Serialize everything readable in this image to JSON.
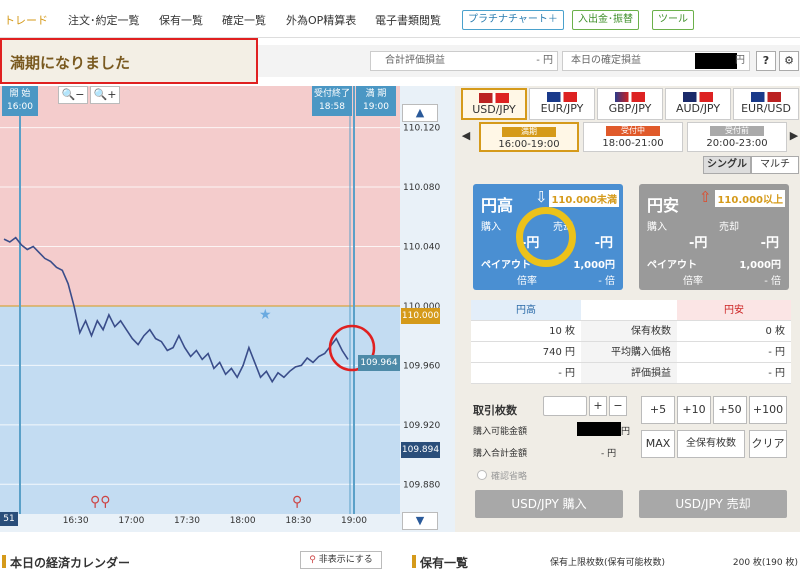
{
  "nav": {
    "items": [
      "トレード",
      "注文･約定一覧",
      "保有一覧",
      "確定一覧",
      "外為OP精算表",
      "電子書類閲覧"
    ],
    "platinum": "プラチナチャート＋",
    "deposit": "入出金･振替",
    "tools": "ツール"
  },
  "banner": {
    "text": "満期になりました"
  },
  "summary": {
    "eval_label": "合計評価損益",
    "eval_value": "- 円",
    "day_label": "本日の確定損益",
    "day_unit": "円",
    "help": "?"
  },
  "chart": {
    "start_label": "開 始",
    "start_time": "16:00",
    "close_label": "受付終了",
    "close_time": "18:58",
    "expiry_label": "満 期",
    "expiry_time": "19:00",
    "x_ticks": [
      "16:00",
      "16:30",
      "17:00",
      "17:30",
      "18:00",
      "18:30",
      "19:00"
    ],
    "x_left_fragment": "51",
    "y_ticks": [
      "110.120",
      "110.080",
      "110.040",
      "110.000",
      "109.960",
      "109.920",
      "109.880"
    ],
    "price_current": "109.964",
    "price_marker": "109.894",
    "strike": "110.000",
    "zoom_out": "−",
    "zoom_in": "+"
  },
  "chart_data": {
    "type": "line",
    "ylim": [
      109.86,
      110.148
    ],
    "xlim": [
      "16:00",
      "19:00"
    ],
    "strike": 110.0,
    "series": [
      {
        "values": [
          110.045,
          110.043,
          110.046,
          110.041,
          110.038,
          110.04,
          110.036,
          110.032,
          110.03,
          110.026,
          110.024,
          110.015,
          110.0,
          109.982,
          109.99,
          109.98,
          109.99,
          109.984,
          109.994,
          109.986,
          109.99,
          109.984,
          109.978,
          109.974,
          109.98,
          109.984,
          109.978,
          109.976,
          109.97,
          109.972,
          109.98,
          109.972,
          109.966,
          109.97,
          109.964,
          109.968,
          109.958,
          109.962,
          109.954,
          109.958,
          109.952,
          109.96,
          109.972,
          109.962,
          109.952,
          109.956,
          109.949,
          109.955,
          109.952,
          109.956,
          109.959,
          109.96,
          109.965,
          109.962,
          109.966,
          109.968,
          109.973,
          109.978,
          109.97,
          109.964
        ]
      }
    ]
  },
  "pairs": [
    {
      "code": "USD/JPY",
      "sel": true
    },
    {
      "code": "EUR/JPY"
    },
    {
      "code": "GBP/JPY"
    },
    {
      "code": "AUD/JPY"
    },
    {
      "code": "EUR/USD"
    }
  ],
  "sessions": [
    {
      "tag": "満期",
      "time": "16:00-19:00",
      "color": "#d59a1a"
    },
    {
      "tag": "受付中",
      "time": "18:00-21:00",
      "color": "#e05a2a"
    },
    {
      "tag": "受付前",
      "time": "20:00-23:00",
      "color": "#aaaaaa"
    }
  ],
  "toggle": {
    "single": "シングル",
    "multi": "マルチ"
  },
  "call": {
    "title": "円高",
    "strike": "110.000未満",
    "buy": "購入",
    "sell": "売却",
    "buy_val": "-円",
    "sell_val": "-円",
    "payout_label": "ペイアウト",
    "payout": "1,000円",
    "ratio_label": "倍率",
    "ratio": "- 倍"
  },
  "put": {
    "title": "円安",
    "strike": "110.000以上",
    "buy": "購入",
    "sell": "売却",
    "buy_val": "-円",
    "sell_val": "-円",
    "payout_label": "ペイアウト",
    "payout": "1,000円",
    "ratio_label": "倍率",
    "ratio": "- 倍"
  },
  "table": {
    "left_head": "円高",
    "right_head": "円安",
    "rows": [
      {
        "l": "10 枚",
        "m": "保有枚数",
        "r": "0 枚"
      },
      {
        "l": "740 円",
        "m": "平均購入価格",
        "r": "- 円"
      },
      {
        "l": "- 円",
        "m": "評価損益",
        "r": "- 円"
      }
    ]
  },
  "trade": {
    "qty_label": "取引枚数",
    "plus": "+",
    "minus": "−",
    "avail_label": "購入可能金額",
    "avail_unit": "円",
    "total_label": "購入合計金額",
    "total_value": "- 円",
    "b5": "+5",
    "b10": "+10",
    "b50": "+50",
    "b100": "+100",
    "max": "MAX",
    "all": "全保有枚数",
    "clear": "クリア",
    "confirm": "確認省略",
    "buy_btn": "USD/JPY 購入",
    "sell_btn": "USD/JPY 売却"
  },
  "calendar": {
    "title": "本日の経済カレンダー",
    "hide": "非表示にする"
  },
  "holdings": {
    "title": "保有一覧",
    "limit_label": "保有上限枚数(保有可能枚数)",
    "limit_value": "200 枚(190 枚)"
  }
}
